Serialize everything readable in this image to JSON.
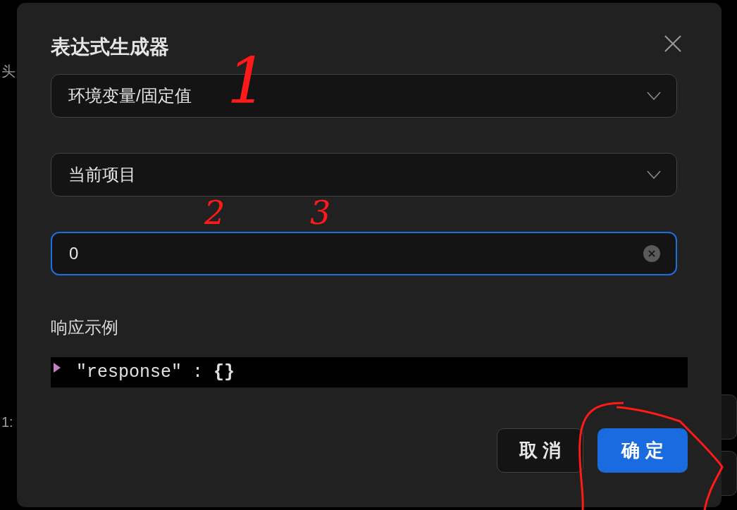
{
  "background": {
    "texts": [
      "头",
      "1:"
    ]
  },
  "dialog": {
    "title": "表达式生成器",
    "selects": [
      {
        "value": "环境变量/固定值"
      },
      {
        "value": "当前项目"
      }
    ],
    "input": {
      "value": "0",
      "focused": true
    },
    "response_label": "响应示例",
    "code": {
      "line": "\"response\" : **{}**",
      "expanded": false
    },
    "buttons": [
      {
        "label": "取 消",
        "kind": "secondary"
      },
      {
        "label": "确 定",
        "kind": "primary"
      }
    ]
  },
  "annotations": [
    {
      "kind": "number",
      "text": "1"
    },
    {
      "kind": "number",
      "text": "2"
    },
    {
      "kind": "number",
      "text": "3"
    },
    {
      "kind": "circle"
    }
  ]
}
